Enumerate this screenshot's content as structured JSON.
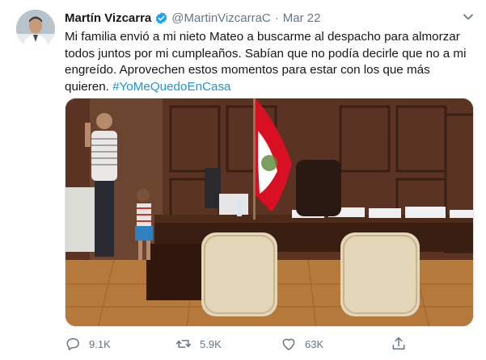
{
  "tweet": {
    "author_name": "Martín Vizcarra",
    "handle": "@MartinVizcarraC",
    "separator": "·",
    "date": "Mar 22",
    "text": "Mi familia envió a mi nieto Mateo a buscarme al despacho para almorzar todos juntos por mi cumpleaños. Sabían que no podía decirle que no a mi engreído. Aprovechen estos momentos para estar con los que más quieren.",
    "hashtag": "#YoMeQuedoEnCasa",
    "verified": true,
    "accent_color": "#1da1f2",
    "link_color": "#1b95e0",
    "muted_color": "#657786"
  },
  "actions": {
    "reply": {
      "icon": "reply-icon",
      "count": "9.1K"
    },
    "retweet": {
      "icon": "retweet-icon",
      "count": "5.9K"
    },
    "like": {
      "icon": "heart-icon",
      "count": "63K"
    },
    "share": {
      "icon": "share-icon"
    }
  },
  "media": {
    "icon": "photo",
    "flag_colors": [
      "#d91023",
      "#ffffff"
    ]
  }
}
